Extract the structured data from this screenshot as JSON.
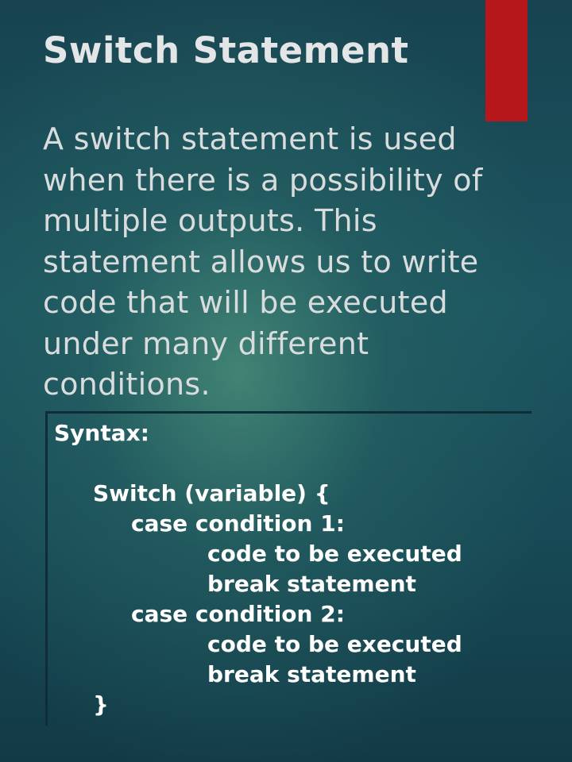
{
  "slide": {
    "title": "Switch Statement",
    "body": "A switch statement is used when there is a possibility of multiple outputs. This statement allows us to write code that will be executed under many different conditions.",
    "code": {
      "label": "Syntax:",
      "lines": [
        "Switch (variable) {",
        "case condition 1:",
        "code to be executed",
        "break statement",
        "case condition 2:",
        "code to be executed",
        "break statement",
        "}"
      ]
    }
  },
  "colors": {
    "background": "#1c5560",
    "accent_bar": "#b5171a",
    "title_text": "#e3e5e6",
    "body_text": "#d9dcdd",
    "code_text": "#ffffff"
  }
}
